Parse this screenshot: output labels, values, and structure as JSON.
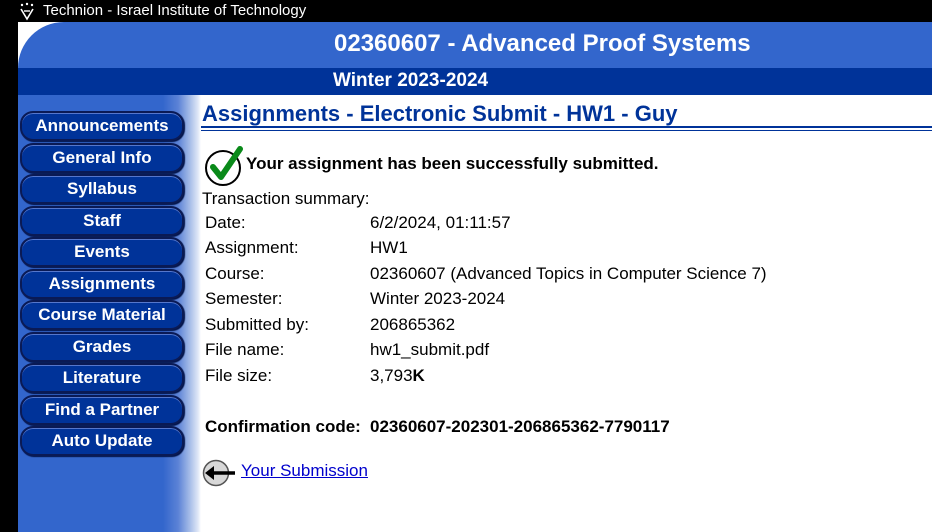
{
  "topbar": {
    "institution": "Technion - Israel Institute of Technology"
  },
  "header": {
    "course_title": "02360607 - Advanced Proof Systems",
    "semester": "Winter 2023-2024"
  },
  "sidebar": {
    "items": [
      {
        "label": "Announcements"
      },
      {
        "label": "General Info"
      },
      {
        "label": "Syllabus"
      },
      {
        "label": "Staff"
      },
      {
        "label": "Events"
      },
      {
        "label": "Assignments"
      },
      {
        "label": "Course Material"
      },
      {
        "label": "Grades"
      },
      {
        "label": "Literature"
      },
      {
        "label": "Find a Partner"
      },
      {
        "label": "Auto Update"
      }
    ]
  },
  "main": {
    "page_title": "Assignments - Electronic Submit - HW1 - Guy",
    "success_message": "Your assignment has been successfully submitted.",
    "summary_label": "Transaction summary:",
    "rows": [
      {
        "label": "Date:",
        "value": "6/2/2024, 01:11:57"
      },
      {
        "label": "Assignment:",
        "value": "HW1"
      },
      {
        "label": "Course:",
        "value": "02360607 (Advanced Topics in Computer Science 7)"
      },
      {
        "label": "Semester:",
        "value": "Winter 2023-2024"
      },
      {
        "label": "Submitted by:",
        "value": "206865362"
      },
      {
        "label": "File name:",
        "value": "hw1_submit.pdf"
      },
      {
        "label": "File size:",
        "value": "3,793",
        "unit": "K"
      }
    ],
    "confirmation_label": "Confirmation code:",
    "confirmation_code": "02360607-202301-206865362-7790117",
    "back_link": "Your Submission"
  },
  "colors": {
    "header_blue": "#3366cc",
    "dark_blue": "#003399",
    "link": "#0000cc",
    "check_green": "#0a8a1a"
  }
}
